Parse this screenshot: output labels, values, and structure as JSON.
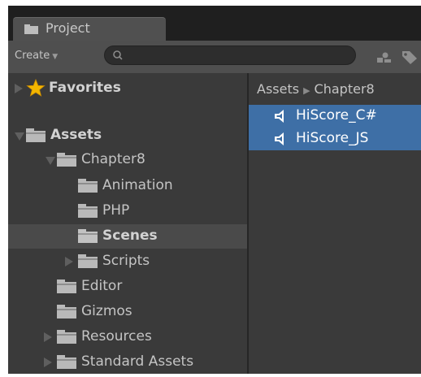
{
  "window": {
    "tab_label": "Project",
    "accent_selected": "#3e6fa6"
  },
  "toolbar": {
    "create_label": "Create",
    "search_placeholder": ""
  },
  "tree": {
    "favorites_label": "Favorites",
    "items": [
      {
        "label": "Assets",
        "bold": true
      },
      {
        "label": "Chapter8"
      },
      {
        "label": "Animation"
      },
      {
        "label": "PHP"
      },
      {
        "label": "Scenes",
        "selected": true
      },
      {
        "label": "Scripts"
      },
      {
        "label": "Editor"
      },
      {
        "label": "Gizmos"
      },
      {
        "label": "Resources"
      },
      {
        "label": "Standard Assets"
      }
    ]
  },
  "breadcrumb": [
    "Assets",
    "Chapter8"
  ],
  "files": [
    {
      "label": "HiScore_C#",
      "icon": "audio-clip-icon"
    },
    {
      "label": "HiScore_JS",
      "icon": "audio-clip-icon"
    }
  ]
}
